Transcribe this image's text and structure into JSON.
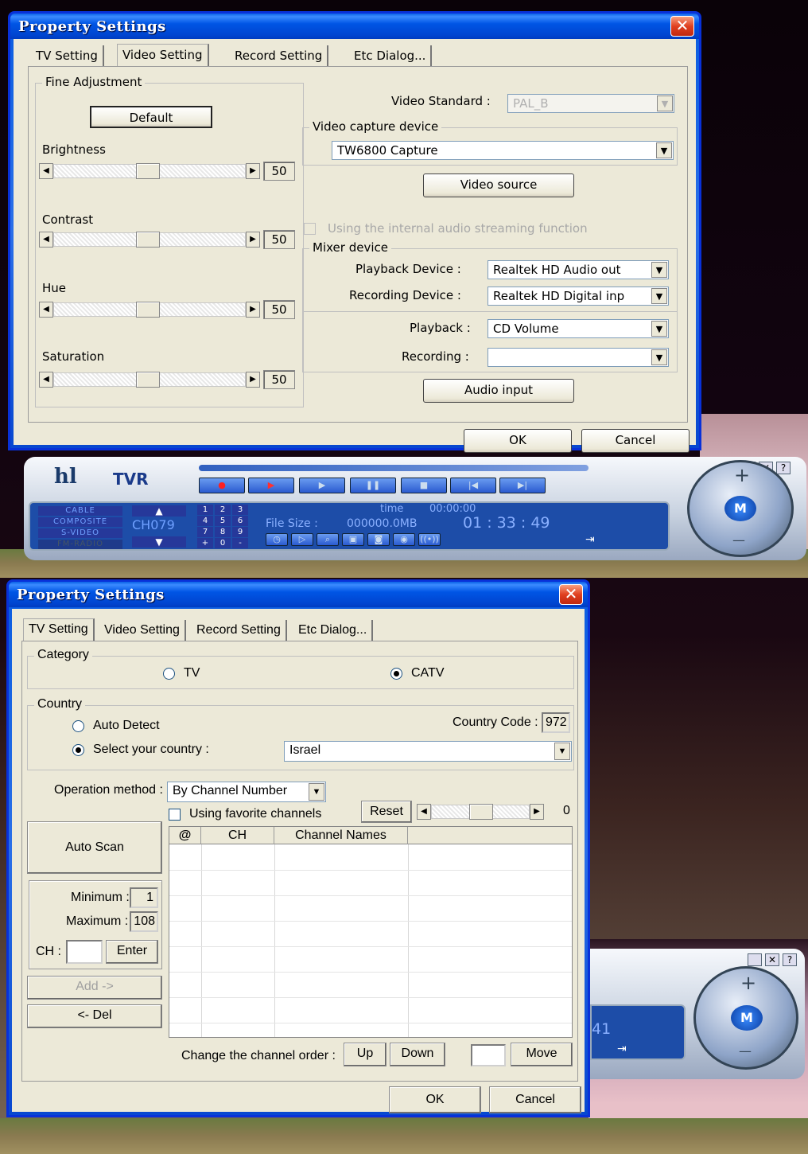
{
  "dialog1": {
    "title": "Property Settings",
    "tabs": [
      "TV Setting",
      "Video Setting",
      "Record Setting",
      "Etc Dialog..."
    ],
    "fine_adjustment": {
      "legend": "Fine Adjustment",
      "default_button": "Default",
      "brightness_label": "Brightness",
      "brightness_value": "50",
      "contrast_label": "Contrast",
      "contrast_value": "50",
      "hue_label": "Hue",
      "hue_value": "50",
      "saturation_label": "Saturation",
      "saturation_value": "50"
    },
    "video_standard_label": "Video Standard :",
    "video_standard_value": "PAL_B",
    "capture_legend": "Video capture device",
    "capture_device": "TW6800 Capture",
    "video_source_button": "Video source",
    "internal_audio_label": "Using the internal audio streaming function",
    "mixer_legend": "Mixer device",
    "playback_device_label": "Playback Device :",
    "playback_device_value": "Realtek HD Audio out",
    "recording_device_label": "Recording Device :",
    "recording_device_value": "Realtek HD Digital inp",
    "playback_label": "Playback :",
    "playback_value": "CD Volume",
    "recording_label": "Recording :",
    "recording_value": "",
    "audio_input_button": "Audio input",
    "ok": "OK",
    "cancel": "Cancel"
  },
  "player": {
    "logo": "hl",
    "brand": "TVR",
    "modes": [
      "CABLE",
      "COMPOSITE",
      "S-VIDEO",
      "FM-RADIO"
    ],
    "channel": "CH079",
    "keypad": [
      "1",
      "2",
      "3",
      "4",
      "5",
      "6",
      "7",
      "8",
      "9",
      "+",
      "0",
      "-"
    ],
    "time_label": "time",
    "time_value": "00:00:00",
    "filesize_label": "File Size :",
    "filesize_value": "000000.0MB",
    "clock": "01 : 33 : 49",
    "knob_center": "M",
    "knob_plus": "+",
    "knob_minus": "—",
    "partial_clock": "41"
  },
  "dialog2": {
    "title": "Property Settings",
    "tabs": [
      "TV Setting",
      "Video Setting",
      "Record Setting",
      "Etc Dialog..."
    ],
    "category_legend": "Category",
    "tv_label": "TV",
    "catv_label": "CATV",
    "country_legend": "Country",
    "auto_detect_label": "Auto Detect",
    "select_country_label": "Select your country :",
    "country_code_label": "Country Code :",
    "country_code_value": "972",
    "country_value": "Israel",
    "operation_label": "Operation method :",
    "operation_value": "By Channel Number",
    "favorite_label": "Using favorite channels",
    "reset_button": "Reset",
    "slider_value": "0",
    "auto_scan_button": "Auto Scan",
    "minimum_label": "Minimum :",
    "minimum_value": "1",
    "maximum_label": "Maximum :",
    "maximum_value": "108",
    "ch_label": "CH :",
    "enter_button": "Enter",
    "add_button": "Add ->",
    "del_button": "<- Del",
    "table_headers": [
      "@",
      "CH",
      "Channel Names",
      ""
    ],
    "change_order_label": "Change the channel order :",
    "up_button": "Up",
    "down_button": "Down",
    "move_button": "Move",
    "ok": "OK",
    "cancel": "Cancel"
  }
}
